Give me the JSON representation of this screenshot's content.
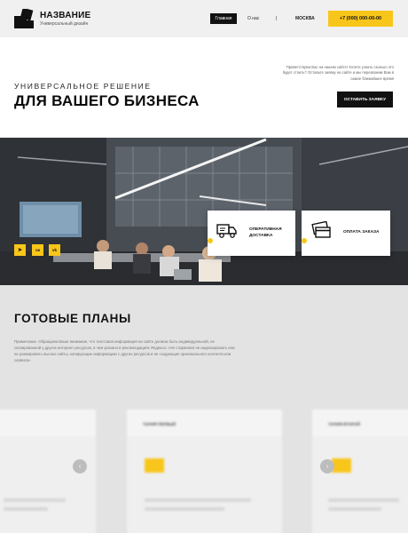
{
  "header": {
    "brand": "НАЗВАНИЕ",
    "tagline": "Универсальный дизайн",
    "nav": {
      "home": "Главная",
      "about": "О нас",
      "separator": "|",
      "city": "МОСКВА"
    },
    "phone": "+7 (000) 000-00-00"
  },
  "hero": {
    "subtitle": "УНИВЕРСАЛЬНОЕ РЕШЕНИЕ",
    "title": "ДЛЯ ВАШЕГО БИЗНЕСА",
    "note": "Приветствуем Вас на нашем сайте! Хотите узнать сколько это будет стоить? Оставьте заявку на сайте и мы перезвоним Вам в самое ближайшее время",
    "order_button": "ОСТАВИТЬ ЗАЯВКУ"
  },
  "features": [
    {
      "label_line1": "ОПЕРАТИВНАЯ",
      "label_line2": "ДОСТАВКА",
      "icon": "delivery-truck-icon"
    },
    {
      "label_line1": "ОПЛАТА ЗАКАЗА",
      "label_line2": "",
      "icon": "payment-card-icon"
    }
  ],
  "social": [
    {
      "icon": "telegram-icon",
      "glyph": "➤"
    },
    {
      "icon": "odnoklassniki-icon",
      "glyph": "ок"
    },
    {
      "icon": "vk-icon",
      "glyph": "vk"
    }
  ],
  "plans": {
    "title": "ГОТОВЫЕ ПЛАНЫ",
    "text": "Примечание. Обращаем Ваше внимание, что текстовая информация на сайте должна быть индивидуальной, не скопированной у других интернет-ресурсов, в чем указано в рекомендациях Яндекса: «Не стараемся не индексировать или не ранжировать высоко сайты, копирующие информацию с других ресурсов и не создающие оригинального контента или сервиса»",
    "cards": [
      {
        "name": ""
      },
      {
        "name": "ТАРИФ ПЕРВЫЙ"
      },
      {
        "name": "ТАРИФ ВТОРОЙ"
      }
    ],
    "prev_glyph": "‹",
    "next_glyph": "›"
  },
  "colors": {
    "accent": "#f8c61a",
    "dark": "#111111",
    "header_bg": "#f0f0f0",
    "section_bg": "#e3e3e3"
  }
}
